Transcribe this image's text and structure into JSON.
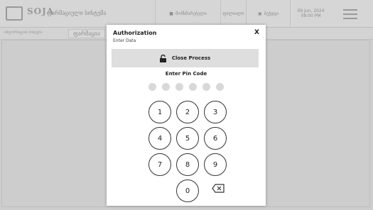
{
  "background": {
    "logo_text": "SOJA",
    "app_title": "ფარმაციული სისტემა",
    "user_name": "მომხმარებელი",
    "segment_2": "ფილიალი",
    "segment_3": "ბეჭდვა",
    "date_line1": "09 Jun, 2024",
    "date_line2": "08:00 PM",
    "sub_left_text": "ინფორმაციის სისტემა",
    "sub_tab_label": "ფარმაცია"
  },
  "modal": {
    "title": "Authorization",
    "subtitle": "Enter Data",
    "close_label": "X",
    "close_process_label": "Close Process",
    "pin_label": "Enter Pin Code",
    "pin_length": 6,
    "keys": [
      "1",
      "2",
      "3",
      "4",
      "5",
      "6",
      "7",
      "8",
      "9",
      "0"
    ]
  },
  "icons": {
    "lock": "unlock-icon",
    "backspace": "backspace-icon",
    "menu": "hamburger-icon",
    "user": "user-icon"
  }
}
